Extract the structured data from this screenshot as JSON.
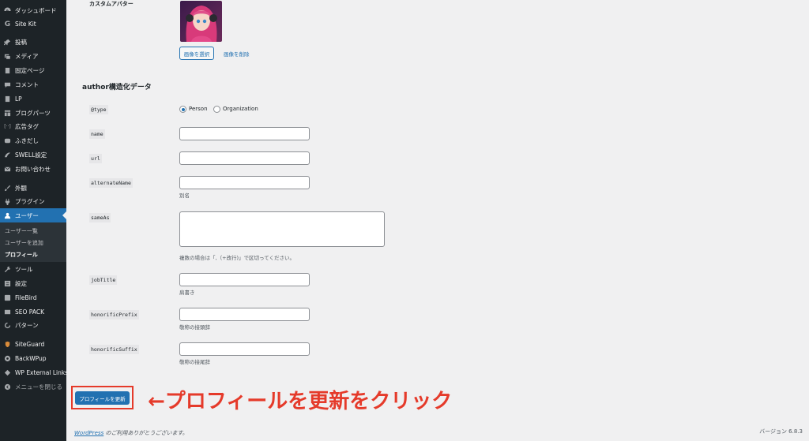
{
  "sidebar": {
    "items": [
      {
        "label": "ダッシュボード",
        "icon": "dashboard-icon"
      },
      {
        "label": "Site Kit",
        "icon": "google-g-icon"
      },
      {
        "label": "投稿",
        "icon": "pin-icon"
      },
      {
        "label": "メディア",
        "icon": "media-icon"
      },
      {
        "label": "固定ページ",
        "icon": "page-icon"
      },
      {
        "label": "コメント",
        "icon": "comment-icon"
      },
      {
        "label": "LP",
        "icon": "page-icon"
      },
      {
        "label": "ブログパーツ",
        "icon": "layout-icon"
      },
      {
        "label": "広告タグ",
        "icon": "ad-icon"
      },
      {
        "label": "ふきだし",
        "icon": "bubble-icon"
      },
      {
        "label": "SWELL設定",
        "icon": "swell-icon"
      },
      {
        "label": "お問い合わせ",
        "icon": "mail-icon"
      },
      {
        "label": "外観",
        "icon": "brush-icon"
      },
      {
        "label": "プラグイン",
        "icon": "plugin-icon"
      },
      {
        "label": "ユーザー",
        "icon": "user-icon"
      },
      {
        "label": "ツール",
        "icon": "wrench-icon"
      },
      {
        "label": "設定",
        "icon": "settings-icon"
      },
      {
        "label": "FileBird",
        "icon": "folder-icon"
      },
      {
        "label": "SEO PACK",
        "icon": "seo-icon"
      },
      {
        "label": "パターン",
        "icon": "pattern-icon"
      },
      {
        "label": "SiteGuard",
        "icon": "shield-icon"
      },
      {
        "label": "BackWPup",
        "icon": "backup-icon"
      },
      {
        "label": "WP External Links",
        "icon": "link-icon"
      },
      {
        "label": "メニューを閉じる",
        "icon": "collapse-icon"
      }
    ],
    "submenu": [
      {
        "label": "ユーザー一覧"
      },
      {
        "label": "ユーザーを追加"
      },
      {
        "label": "プロフィール"
      }
    ]
  },
  "avatar": {
    "label": "カスタムアバター",
    "select_button": "画像を選択",
    "delete_button": "画像を削除"
  },
  "section_heading": "author構造化データ",
  "fields": {
    "type": {
      "label": "@type",
      "options": [
        "Person",
        "Organization"
      ],
      "selected": "Person"
    },
    "name": {
      "label": "name",
      "value": ""
    },
    "url": {
      "label": "url",
      "value": ""
    },
    "alternateName": {
      "label": "alternateName",
      "value": "",
      "description": "別名"
    },
    "sameAs": {
      "label": "sameAs",
      "value": "",
      "description": "複数の場合は「,（+改行)」で区切ってください。"
    },
    "jobTitle": {
      "label": "jobTitle",
      "value": "",
      "description": "肩書き"
    },
    "honorificPrefix": {
      "label": "honorificPrefix",
      "value": "",
      "description": "敬称の接頭辞"
    },
    "honorificSuffix": {
      "label": "honorificSuffix",
      "value": "",
      "description": "敬称の接尾辞"
    }
  },
  "submit_button": "プロフィールを更新",
  "annotation": "←プロフィールを更新をクリック",
  "footer": {
    "link": "WordPress",
    "text": " のご利用ありがとうございます。",
    "version": "バージョン 6.8.3"
  },
  "colors": {
    "sidebar_bg": "#1d2327",
    "accent": "#2271b1",
    "annotation": "#e53a2a",
    "page_bg": "#f0f0f1"
  }
}
